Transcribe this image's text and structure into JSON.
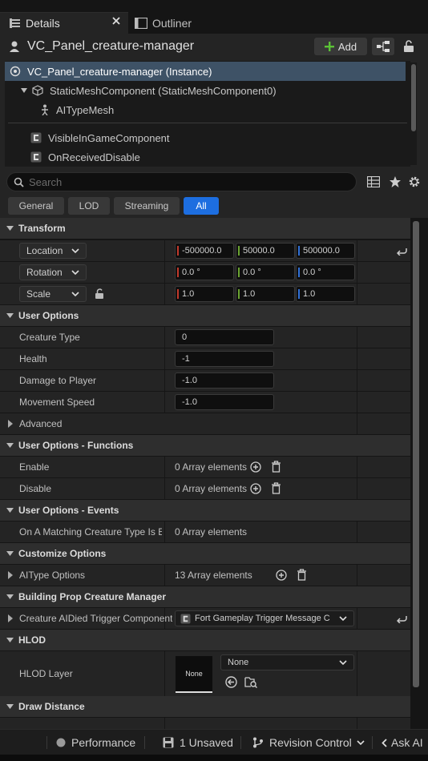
{
  "tabs": [
    {
      "label": "Details",
      "active": true
    },
    {
      "label": "Outliner",
      "active": false
    }
  ],
  "header": {
    "title": "VC_Panel_creature-manager",
    "add_label": "Add"
  },
  "tree": {
    "rows": [
      {
        "label": "VC_Panel_creature-manager (Instance)",
        "selected": true
      },
      {
        "label": "StaticMeshComponent (StaticMeshComponent0)"
      },
      {
        "label": "AITypeMesh"
      },
      {
        "label": "VisibleInGameComponent"
      },
      {
        "label": "OnReceivedDisable"
      }
    ]
  },
  "search": {
    "placeholder": "Search",
    "value": ""
  },
  "filters": [
    {
      "label": "General",
      "active": false
    },
    {
      "label": "LOD",
      "active": false
    },
    {
      "label": "Streaming",
      "active": false
    },
    {
      "label": "All",
      "active": true
    }
  ],
  "transform": {
    "category": "Transform",
    "location": {
      "label": "Location",
      "x": "-500000.0",
      "y": "50000.0",
      "z": "500000.0"
    },
    "rotation": {
      "label": "Rotation",
      "x": "0.0 °",
      "y": "0.0 °",
      "z": "0.0 °"
    },
    "scale": {
      "label": "Scale",
      "x": "1.0",
      "y": "1.0",
      "z": "1.0"
    }
  },
  "user_options": {
    "category": "User Options",
    "creature_type": {
      "label": "Creature Type",
      "value": "0"
    },
    "health": {
      "label": "Health",
      "value": "-1"
    },
    "damage": {
      "label": "Damage to Player",
      "value": "-1.0"
    },
    "movement": {
      "label": "Movement Speed",
      "value": "-1.0"
    },
    "advanced": "Advanced"
  },
  "functions": {
    "category": "User Options - Functions",
    "enable": {
      "label": "Enable",
      "value": "0 Array elements"
    },
    "disable": {
      "label": "Disable",
      "value": "0 Array elements"
    }
  },
  "events": {
    "category": "User Options - Events",
    "matching": {
      "label": "On A Matching Creature Type Is El...",
      "value": "0 Array elements"
    }
  },
  "customize": {
    "category": "Customize Options",
    "aitype": {
      "label": "AIType Options",
      "value": "13 Array elements"
    }
  },
  "building": {
    "category": "Building Prop Creature Manager",
    "trigger": {
      "label": "Creature AIDied Trigger Component",
      "value": "Fort Gameplay Trigger Message C"
    }
  },
  "hlod": {
    "category": "HLOD",
    "layer": {
      "label": "HLOD Layer",
      "thumb": "None",
      "value": "None"
    }
  },
  "draw_distance": {
    "category": "Draw Distance"
  },
  "status": {
    "performance": "Performance",
    "unsaved": "1 Unsaved",
    "revision": "Revision Control",
    "askai": "Ask AI"
  },
  "colors": {
    "accent": "#1d6ee0",
    "selected_row": "#3e5266",
    "x_axis": "#c0392b",
    "y_axis": "#6aa330",
    "z_axis": "#2f6fd6",
    "add_icon": "#5bc236"
  }
}
